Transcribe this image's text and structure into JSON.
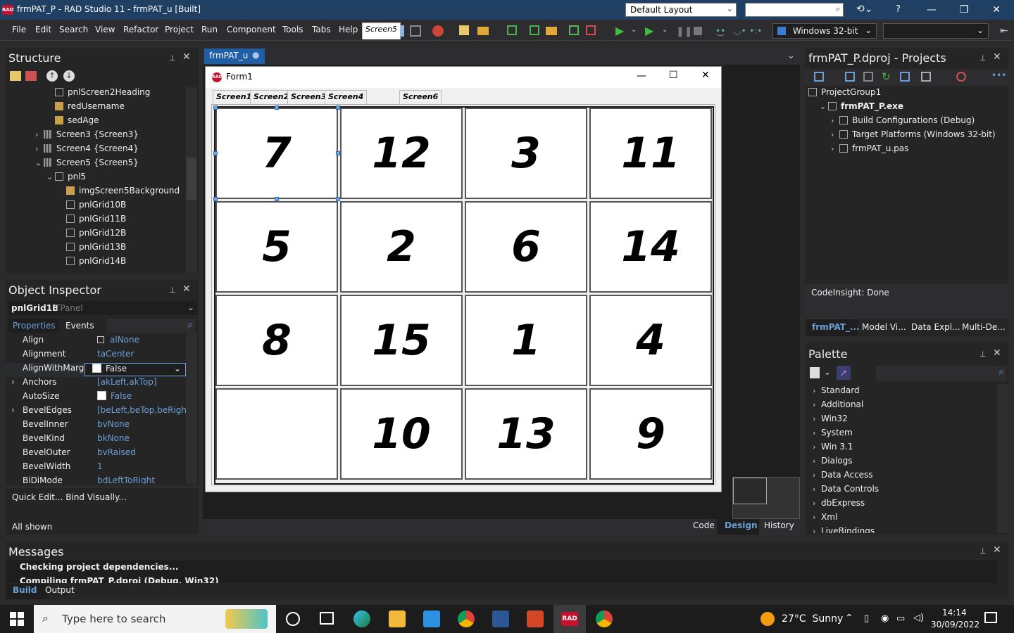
{
  "window": {
    "title": "frmPAT_P - RAD Studio 11 - frmPAT_u [Built]",
    "app_badge": "RAD",
    "layout_combo": "Default Layout",
    "help_glyph": "?"
  },
  "menu": [
    "File",
    "Edit",
    "Search",
    "View",
    "Refactor",
    "Project",
    "Run",
    "Component",
    "Tools",
    "Tabs",
    "Help"
  ],
  "platform_combo": "Windows 32-bit",
  "structure": {
    "title": "Structure",
    "items": [
      {
        "label": "pnlScreen2Heading",
        "indent": 3,
        "icon": "box"
      },
      {
        "label": "redUsername",
        "indent": 3,
        "icon": "ico"
      },
      {
        "label": "sedAge",
        "indent": 3,
        "icon": "ico"
      },
      {
        "label": "Screen3 {Screen3}",
        "indent": 2,
        "icon": "grid",
        "exp": "›"
      },
      {
        "label": "Screen4 {Screen4}",
        "indent": 2,
        "icon": "grid",
        "exp": "›"
      },
      {
        "label": "Screen5 {Screen5}",
        "indent": 2,
        "icon": "grid",
        "exp": "⌄"
      },
      {
        "label": "pnl5",
        "indent": 3,
        "icon": "box",
        "exp": "⌄"
      },
      {
        "label": "imgScreen5Background",
        "indent": 4,
        "icon": "ico"
      },
      {
        "label": "pnlGrid10B",
        "indent": 4,
        "icon": "box"
      },
      {
        "label": "pnlGrid11B",
        "indent": 4,
        "icon": "box"
      },
      {
        "label": "pnlGrid12B",
        "indent": 4,
        "icon": "box"
      },
      {
        "label": "pnlGrid13B",
        "indent": 4,
        "icon": "box"
      },
      {
        "label": "pnlGrid14B",
        "indent": 4,
        "icon": "box"
      }
    ]
  },
  "object_inspector": {
    "title": "Object Inspector",
    "selected_name": "pnlGrid1B",
    "selected_type": "TPanel",
    "tab_properties": "Properties",
    "tab_events": "Events",
    "rows": [
      {
        "name": "Align",
        "value": "alNone"
      },
      {
        "name": "Alignment",
        "value": "taCenter"
      },
      {
        "name": "AlignWithMargin",
        "value": "False",
        "check": true,
        "selected": true
      },
      {
        "name": "Anchors",
        "value": "[akLeft,akTop]",
        "exp": true
      },
      {
        "name": "AutoSize",
        "value": "False",
        "check": true
      },
      {
        "name": "BevelEdges",
        "value": "[beLeft,beTop,beRight,bel",
        "exp": true
      },
      {
        "name": "BevelInner",
        "value": "bvNone"
      },
      {
        "name": "BevelKind",
        "value": "bkNone"
      },
      {
        "name": "BevelOuter",
        "value": "bvRaised"
      },
      {
        "name": "BevelWidth",
        "value": "1"
      },
      {
        "name": "BiDiMode",
        "value": "bdLeftToRight"
      }
    ],
    "quick_edit": "Quick Edit... Bind Visually...",
    "footer": "All shown"
  },
  "editor": {
    "tab_label": "frmPAT_u",
    "form_caption": "Form1",
    "form_icon": "RAD",
    "screen_tabs": [
      "Screen1",
      "Screen2",
      "Screen3",
      "Screen4",
      "Screen5",
      "Screen6"
    ],
    "active_screen_tab": "Screen5",
    "grid": [
      [
        "7",
        "12",
        "3",
        "11"
      ],
      [
        "5",
        "2",
        "6",
        "14"
      ],
      [
        "8",
        "15",
        "1",
        "4"
      ],
      [
        "",
        "10",
        "13",
        "9"
      ]
    ],
    "bottom_tabs": [
      "Code",
      "Design",
      "History"
    ]
  },
  "projects": {
    "title": "frmPAT_P.dproj - Projects",
    "items": [
      {
        "label": "ProjectGroup1",
        "indent": 0
      },
      {
        "label": "frmPAT_P.exe",
        "indent": 1,
        "exp": "⌄",
        "bold": true
      },
      {
        "label": "Build Configurations (Debug)",
        "indent": 2,
        "exp": "›"
      },
      {
        "label": "Target Platforms (Windows 32-bit)",
        "indent": 2,
        "exp": "›"
      },
      {
        "label": "frmPAT_u.pas",
        "indent": 2,
        "exp": "›"
      }
    ],
    "codeinsight": "CodeInsight: Done",
    "bottom_tabs": [
      "frmPAT_...",
      "Model Vi...",
      "Data Expl...",
      "Multi-De..."
    ]
  },
  "palette": {
    "title": "Palette",
    "items": [
      "Standard",
      "Additional",
      "Win32",
      "System",
      "Win 3.1",
      "Dialogs",
      "Data Access",
      "Data Controls",
      "dbExpress",
      "Xml",
      "LiveBindings"
    ]
  },
  "messages": {
    "title": "Messages",
    "lines": [
      "Checking project dependencies...",
      "Compiling frmPAT_P.dproj (Debug, Win32)"
    ],
    "tabs": [
      "Build",
      "Output"
    ]
  },
  "taskbar": {
    "search_placeholder": "Type here to search",
    "weather": "27°C  Sunny",
    "time": "14:14",
    "date": "30/09/2022",
    "rad_label": "RAD"
  },
  "colors": {
    "title_bar": "#1f3f63",
    "accent_blue": "#6c9fd6",
    "panel_bg": "#252526"
  }
}
